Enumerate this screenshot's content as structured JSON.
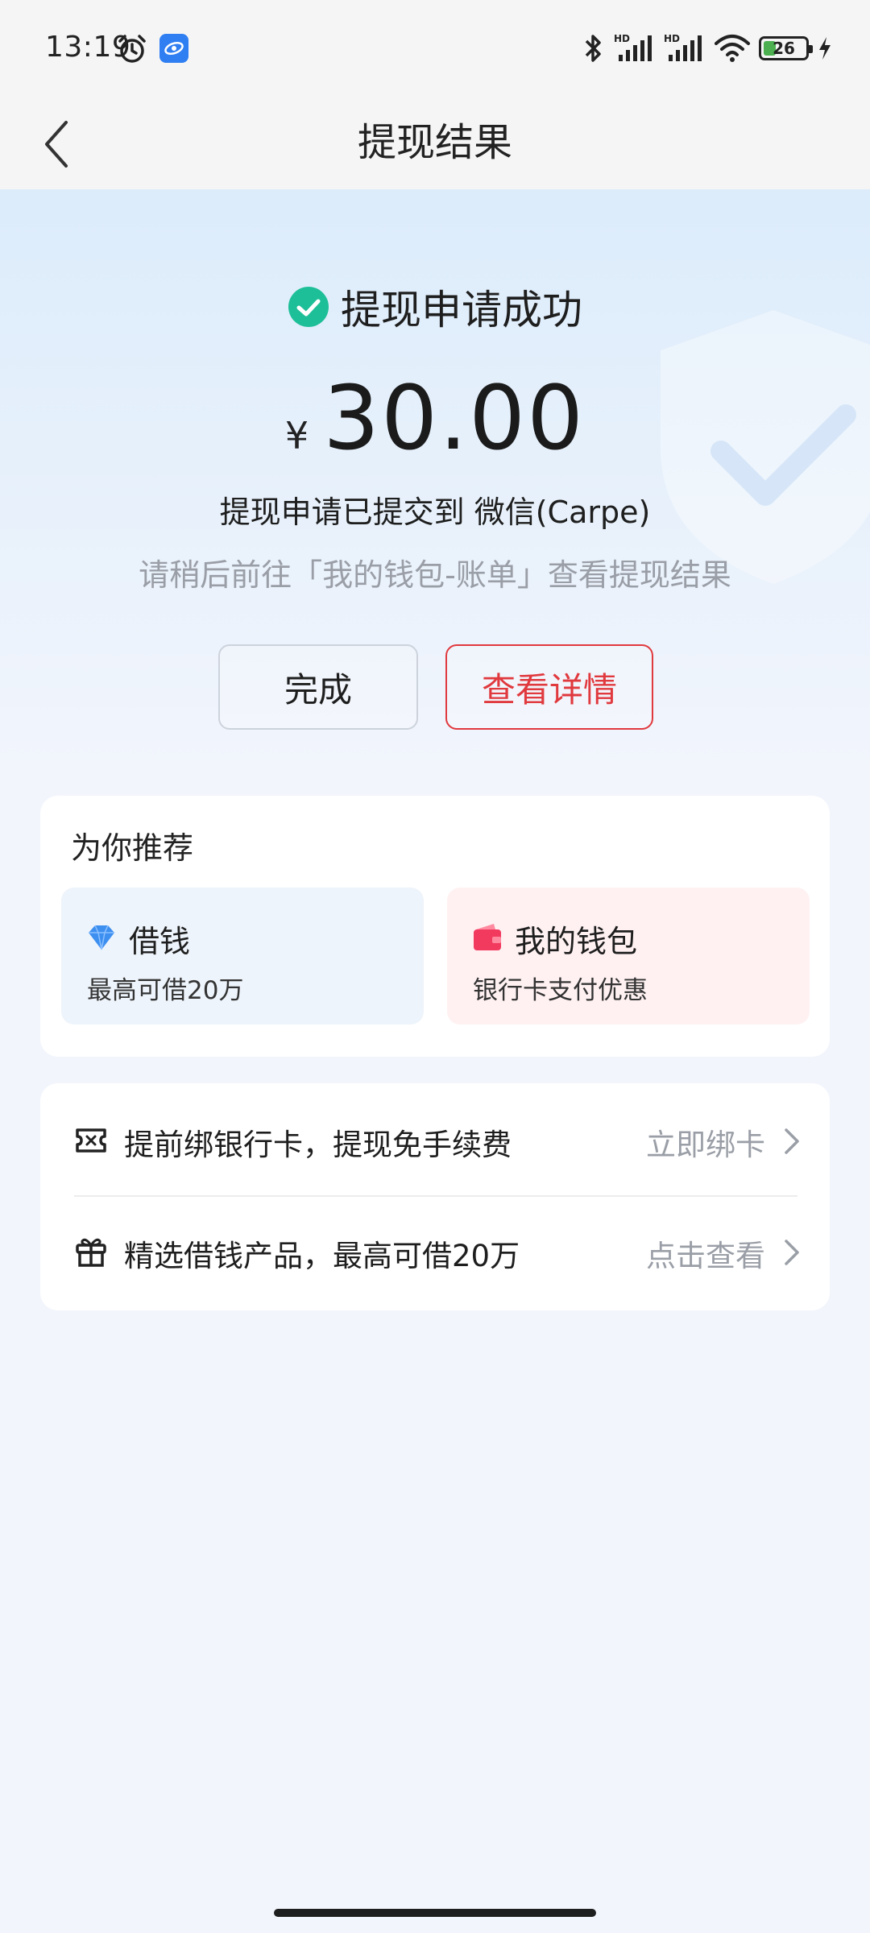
{
  "status_bar": {
    "time": "13:19",
    "battery_level": "26",
    "icons": [
      "alarm-icon",
      "app-notification-icon",
      "bluetooth-icon",
      "hd-signal-icon",
      "hd-signal-icon",
      "wifi-icon",
      "battery-icon",
      "charging-icon"
    ]
  },
  "nav": {
    "title": "提现结果",
    "back_icon": "chevron-left-icon"
  },
  "result": {
    "status_text": "提现申请成功",
    "status_icon": "check-circle-icon",
    "currency": "¥",
    "amount": "30.00",
    "submitted_text": "提现申请已提交到 微信(Carpe)",
    "hint_text": "请稍后前往「我的钱包-账单」查看提现结果"
  },
  "actions": {
    "done_label": "完成",
    "detail_label": "查看详情"
  },
  "recommend": {
    "title": "为你推荐",
    "tiles": [
      {
        "title": "借钱",
        "subtitle": "最高可借20万",
        "icon": "diamond-icon"
      },
      {
        "title": "我的钱包",
        "subtitle": "银行卡支付优惠",
        "icon": "wallet-icon"
      }
    ]
  },
  "list": [
    {
      "text": "提前绑银行卡，提现免手续费",
      "action": "立即绑卡",
      "icon": "ticket-icon"
    },
    {
      "text": "精选借钱产品，最高可借20万",
      "action": "点击查看",
      "icon": "gift-icon"
    }
  ],
  "colors": {
    "accent_red": "#e0393e",
    "success_green": "#1dbf98",
    "diamond_blue": "#3d8ff0",
    "wallet_pink": "#f23a5f",
    "muted_text": "#9a9ea6"
  }
}
